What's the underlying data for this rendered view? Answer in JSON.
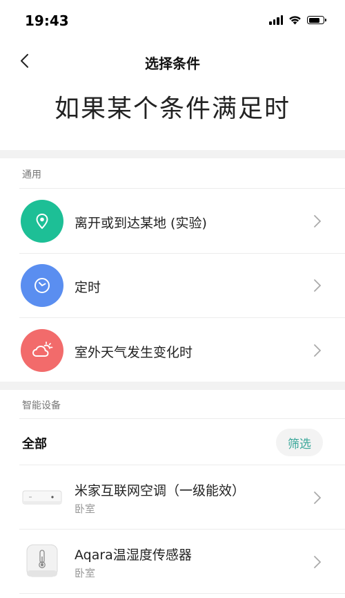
{
  "status_bar": {
    "time": "19:43"
  },
  "nav": {
    "title": "选择条件"
  },
  "headline": "如果某个条件满足时",
  "general": {
    "label": "通用",
    "items": [
      {
        "label": "离开或到达某地 (实验)",
        "icon": "location-pin-icon",
        "color": "#1dbf96"
      },
      {
        "label": "定时",
        "icon": "clock-icon",
        "color": "#5a8ef0"
      },
      {
        "label": "室外天气发生变化时",
        "icon": "weather-icon",
        "color": "#f26b6b"
      }
    ]
  },
  "devices": {
    "label": "智能设备",
    "filter_all": "全部",
    "filter_button": "筛选",
    "items": [
      {
        "name": "米家互联网空调（一级能效）",
        "room": "卧室",
        "icon": "air-conditioner-icon"
      },
      {
        "name": "Aqara温湿度传感器",
        "room": "卧室",
        "icon": "thermometer-icon"
      }
    ]
  },
  "colors": {
    "accent": "#3aa79a",
    "divider": "#f2f2f2"
  }
}
